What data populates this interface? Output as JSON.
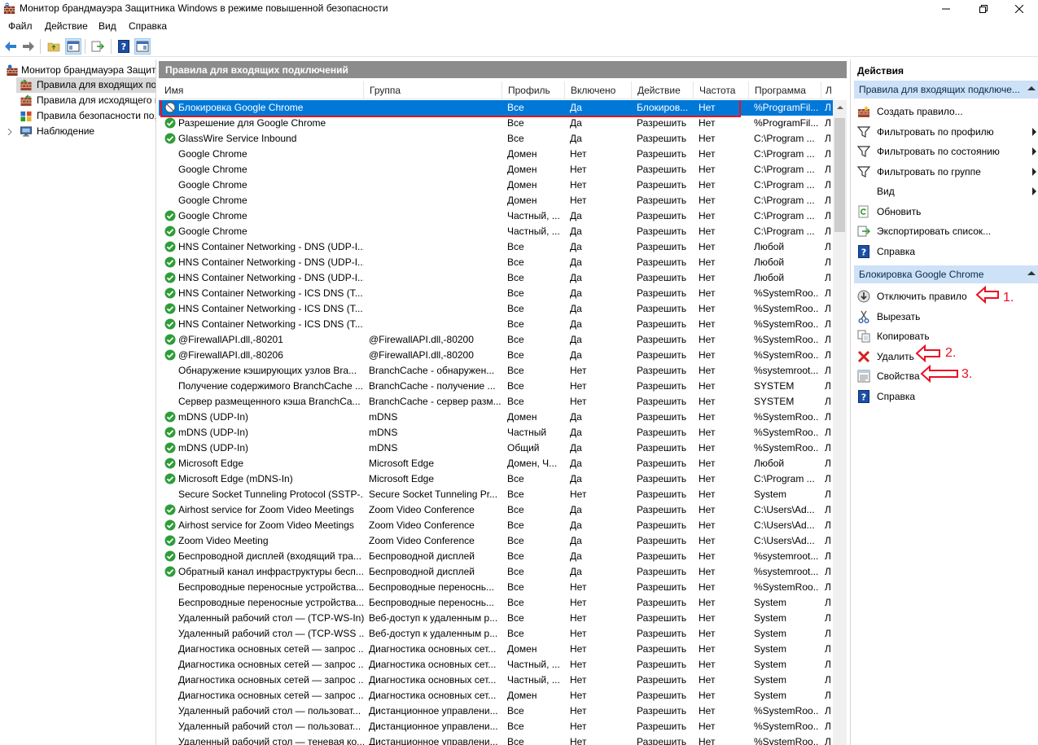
{
  "window": {
    "title": "Монитор брандмауэра Защитника Windows в режиме повышенной безопасности"
  },
  "menu": [
    "Файл",
    "Действие",
    "Вид",
    "Справка"
  ],
  "tree": [
    {
      "label": "Монитор брандмауэра Защит",
      "icon": "firewall-icon"
    },
    {
      "label": "Правила для входящих по",
      "icon": "inbound-rules-icon"
    },
    {
      "label": "Правила для исходящего п",
      "icon": "outbound-rules-icon"
    },
    {
      "label": "Правила безопасности по,",
      "icon": "security-rules-icon"
    },
    {
      "label": "Наблюдение",
      "icon": "monitoring-icon"
    }
  ],
  "middle": {
    "header": "Правила для входящих подключений",
    "columns": [
      "Имя",
      "Группа",
      "Профиль",
      "Включено",
      "Действие",
      "Частота",
      "Программа",
      "Л"
    ]
  },
  "rules": [
    {
      "icon": "block",
      "name": "Блокировка Google Chrome",
      "group": "",
      "profile": "Все",
      "enabled": "Да",
      "action": "Блокиров...",
      "freq": "Нет",
      "program": "%ProgramFil..."
    },
    {
      "icon": "allow",
      "name": "Разрешение для Google Chrome",
      "group": "",
      "profile": "Все",
      "enabled": "Да",
      "action": "Разрешить",
      "freq": "Нет",
      "program": "%ProgramFil..."
    },
    {
      "icon": "allow",
      "name": "GlassWire Service Inbound",
      "group": "",
      "profile": "Все",
      "enabled": "Да",
      "action": "Разрешить",
      "freq": "Нет",
      "program": "C:\\Program ..."
    },
    {
      "icon": "none",
      "name": "Google Chrome",
      "group": "",
      "profile": "Домен",
      "enabled": "Нет",
      "action": "Разрешить",
      "freq": "Нет",
      "program": "C:\\Program ..."
    },
    {
      "icon": "none",
      "name": "Google Chrome",
      "group": "",
      "profile": "Домен",
      "enabled": "Нет",
      "action": "Разрешить",
      "freq": "Нет",
      "program": "C:\\Program ..."
    },
    {
      "icon": "none",
      "name": "Google Chrome",
      "group": "",
      "profile": "Домен",
      "enabled": "Нет",
      "action": "Разрешить",
      "freq": "Нет",
      "program": "C:\\Program ..."
    },
    {
      "icon": "none",
      "name": "Google Chrome",
      "group": "",
      "profile": "Домен",
      "enabled": "Нет",
      "action": "Разрешить",
      "freq": "Нет",
      "program": "C:\\Program ..."
    },
    {
      "icon": "allow",
      "name": "Google Chrome",
      "group": "",
      "profile": "Частный, ...",
      "enabled": "Да",
      "action": "Разрешить",
      "freq": "Нет",
      "program": "C:\\Program ..."
    },
    {
      "icon": "allow",
      "name": "Google Chrome",
      "group": "",
      "profile": "Частный, ...",
      "enabled": "Да",
      "action": "Разрешить",
      "freq": "Нет",
      "program": "C:\\Program ..."
    },
    {
      "icon": "allow",
      "name": "HNS Container Networking - DNS (UDP-I...",
      "group": "",
      "profile": "Все",
      "enabled": "Да",
      "action": "Разрешить",
      "freq": "Нет",
      "program": "Любой"
    },
    {
      "icon": "allow",
      "name": "HNS Container Networking - DNS (UDP-I...",
      "group": "",
      "profile": "Все",
      "enabled": "Да",
      "action": "Разрешить",
      "freq": "Нет",
      "program": "Любой"
    },
    {
      "icon": "allow",
      "name": "HNS Container Networking - DNS (UDP-I...",
      "group": "",
      "profile": "Все",
      "enabled": "Да",
      "action": "Разрешить",
      "freq": "Нет",
      "program": "Любой"
    },
    {
      "icon": "allow",
      "name": "HNS Container Networking - ICS DNS (T...",
      "group": "",
      "profile": "Все",
      "enabled": "Да",
      "action": "Разрешить",
      "freq": "Нет",
      "program": "%SystemRoo..."
    },
    {
      "icon": "allow",
      "name": "HNS Container Networking - ICS DNS (T...",
      "group": "",
      "profile": "Все",
      "enabled": "Да",
      "action": "Разрешить",
      "freq": "Нет",
      "program": "%SystemRoo..."
    },
    {
      "icon": "allow",
      "name": "HNS Container Networking - ICS DNS (T...",
      "group": "",
      "profile": "Все",
      "enabled": "Да",
      "action": "Разрешить",
      "freq": "Нет",
      "program": "%SystemRoo..."
    },
    {
      "icon": "allow",
      "name": "@FirewallAPI.dll,-80201",
      "group": "@FirewallAPI.dll,-80200",
      "profile": "Все",
      "enabled": "Да",
      "action": "Разрешить",
      "freq": "Нет",
      "program": "%SystemRoo..."
    },
    {
      "icon": "allow",
      "name": "@FirewallAPI.dll,-80206",
      "group": "@FirewallAPI.dll,-80200",
      "profile": "Все",
      "enabled": "Да",
      "action": "Разрешить",
      "freq": "Нет",
      "program": "%SystemRoo..."
    },
    {
      "icon": "none",
      "name": "Обнаружение кэширующих узлов Bra...",
      "group": "BranchCache - обнаружен...",
      "profile": "Все",
      "enabled": "Нет",
      "action": "Разрешить",
      "freq": "Нет",
      "program": "%systemroot..."
    },
    {
      "icon": "none",
      "name": "Получение содержимого BranchCache ...",
      "group": "BranchCache - получение ...",
      "profile": "Все",
      "enabled": "Нет",
      "action": "Разрешить",
      "freq": "Нет",
      "program": "SYSTEM"
    },
    {
      "icon": "none",
      "name": "Сервер размещенного кэша BranchCa...",
      "group": "BranchCache - сервер разм...",
      "profile": "Все",
      "enabled": "Нет",
      "action": "Разрешить",
      "freq": "Нет",
      "program": "SYSTEM"
    },
    {
      "icon": "allow",
      "name": "mDNS (UDP-In)",
      "group": "mDNS",
      "profile": "Домен",
      "enabled": "Да",
      "action": "Разрешить",
      "freq": "Нет",
      "program": "%SystemRoo..."
    },
    {
      "icon": "allow",
      "name": "mDNS (UDP-In)",
      "group": "mDNS",
      "profile": "Частный",
      "enabled": "Да",
      "action": "Разрешить",
      "freq": "Нет",
      "program": "%SystemRoo..."
    },
    {
      "icon": "allow",
      "name": "mDNS (UDP-In)",
      "group": "mDNS",
      "profile": "Общий",
      "enabled": "Да",
      "action": "Разрешить",
      "freq": "Нет",
      "program": "%SystemRoo..."
    },
    {
      "icon": "allow",
      "name": "Microsoft Edge",
      "group": "Microsoft Edge",
      "profile": "Домен, Ч...",
      "enabled": "Да",
      "action": "Разрешить",
      "freq": "Нет",
      "program": "Любой"
    },
    {
      "icon": "allow",
      "name": "Microsoft Edge (mDNS-In)",
      "group": "Microsoft Edge",
      "profile": "Все",
      "enabled": "Да",
      "action": "Разрешить",
      "freq": "Нет",
      "program": "C:\\Program ..."
    },
    {
      "icon": "none",
      "name": "Secure Socket Tunneling Protocol (SSTP-...",
      "group": "Secure Socket Tunneling Pr...",
      "profile": "Все",
      "enabled": "Нет",
      "action": "Разрешить",
      "freq": "Нет",
      "program": "System"
    },
    {
      "icon": "allow",
      "name": "Airhost service for Zoom Video Meetings",
      "group": "Zoom Video Conference",
      "profile": "Все",
      "enabled": "Да",
      "action": "Разрешить",
      "freq": "Нет",
      "program": "C:\\Users\\Ad..."
    },
    {
      "icon": "allow",
      "name": "Airhost service for Zoom Video Meetings",
      "group": "Zoom Video Conference",
      "profile": "Все",
      "enabled": "Да",
      "action": "Разрешить",
      "freq": "Нет",
      "program": "C:\\Users\\Ad..."
    },
    {
      "icon": "allow",
      "name": "Zoom Video Meeting",
      "group": "Zoom Video Conference",
      "profile": "Все",
      "enabled": "Да",
      "action": "Разрешить",
      "freq": "Нет",
      "program": "C:\\Users\\Ad..."
    },
    {
      "icon": "allow",
      "name": "Беспроводной дисплей (входящий тра...",
      "group": "Беспроводной дисплей",
      "profile": "Все",
      "enabled": "Да",
      "action": "Разрешить",
      "freq": "Нет",
      "program": "%systemroot..."
    },
    {
      "icon": "allow",
      "name": "Обратный канал инфраструктуры бесп...",
      "group": "Беспроводной дисплей",
      "profile": "Все",
      "enabled": "Да",
      "action": "Разрешить",
      "freq": "Нет",
      "program": "%systemroot..."
    },
    {
      "icon": "none",
      "name": "Беспроводные переносные устройства...",
      "group": "Беспроводные переноснь...",
      "profile": "Все",
      "enabled": "Нет",
      "action": "Разрешить",
      "freq": "Нет",
      "program": "%SystemRoo..."
    },
    {
      "icon": "none",
      "name": "Беспроводные переносные устройства...",
      "group": "Беспроводные переноснь...",
      "profile": "Все",
      "enabled": "Нет",
      "action": "Разрешить",
      "freq": "Нет",
      "program": "System"
    },
    {
      "icon": "none",
      "name": "Удаленный рабочий стол — (TCP-WS-In)",
      "group": "Веб-доступ к удаленным р...",
      "profile": "Все",
      "enabled": "Нет",
      "action": "Разрешить",
      "freq": "Нет",
      "program": "System"
    },
    {
      "icon": "none",
      "name": "Удаленный рабочий стол — (TCP-WSS ...",
      "group": "Веб-доступ к удаленным р...",
      "profile": "Все",
      "enabled": "Нет",
      "action": "Разрешить",
      "freq": "Нет",
      "program": "System"
    },
    {
      "icon": "none",
      "name": "Диагностика основных сетей — запрос ...",
      "group": "Диагностика основных сет...",
      "profile": "Домен",
      "enabled": "Нет",
      "action": "Разрешить",
      "freq": "Нет",
      "program": "System"
    },
    {
      "icon": "none",
      "name": "Диагностика основных сетей — запрос ...",
      "group": "Диагностика основных сет...",
      "profile": "Частный, ...",
      "enabled": "Нет",
      "action": "Разрешить",
      "freq": "Нет",
      "program": "System"
    },
    {
      "icon": "none",
      "name": "Диагностика основных сетей — запрос ...",
      "group": "Диагностика основных сет...",
      "profile": "Частный, ...",
      "enabled": "Нет",
      "action": "Разрешить",
      "freq": "Нет",
      "program": "System"
    },
    {
      "icon": "none",
      "name": "Диагностика основных сетей — запрос ...",
      "group": "Диагностика основных сет...",
      "profile": "Домен",
      "enabled": "Нет",
      "action": "Разрешить",
      "freq": "Нет",
      "program": "System"
    },
    {
      "icon": "none",
      "name": "Удаленный рабочий стол — пользоват...",
      "group": "Дистанционное управлени...",
      "profile": "Все",
      "enabled": "Нет",
      "action": "Разрешить",
      "freq": "Нет",
      "program": "%SystemRoo..."
    },
    {
      "icon": "none",
      "name": "Удаленный рабочий стол — пользоват...",
      "group": "Дистанционное управлени...",
      "profile": "Все",
      "enabled": "Нет",
      "action": "Разрешить",
      "freq": "Нет",
      "program": "%SystemRoo..."
    },
    {
      "icon": "none",
      "name": "Удаленный рабочий стол — теневая ко...",
      "group": "Дистанционное управлени...",
      "profile": "Все",
      "enabled": "Нет",
      "action": "Разрешить",
      "freq": "Нет",
      "program": "%SystemRoo..."
    }
  ],
  "actions_panel": {
    "title": "Действия",
    "sections": [
      {
        "header": "Правила для входящих подключе...",
        "items": [
          {
            "label": "Создать правило...",
            "icon": "new-rule-icon",
            "submenu": false
          },
          {
            "label": "Фильтровать по профилю",
            "icon": "filter-icon",
            "submenu": true
          },
          {
            "label": "Фильтровать по состоянию",
            "icon": "filter-icon",
            "submenu": true
          },
          {
            "label": "Фильтровать по группе",
            "icon": "filter-icon",
            "submenu": true
          },
          {
            "label": "Вид",
            "icon": "none",
            "submenu": true
          },
          {
            "label": "Обновить",
            "icon": "refresh-icon",
            "submenu": false
          },
          {
            "label": "Экспортировать список...",
            "icon": "export-icon",
            "submenu": false
          },
          {
            "label": "Справка",
            "icon": "help-icon",
            "submenu": false
          }
        ]
      },
      {
        "header": "Блокировка Google Chrome",
        "items": [
          {
            "label": "Отключить правило",
            "icon": "disable-icon",
            "submenu": false
          },
          {
            "label": "Вырезать",
            "icon": "cut-icon",
            "submenu": false
          },
          {
            "label": "Копировать",
            "icon": "copy-icon",
            "submenu": false
          },
          {
            "label": "Удалить",
            "icon": "delete-icon",
            "submenu": false
          },
          {
            "label": "Свойства",
            "icon": "properties-icon",
            "submenu": false
          },
          {
            "label": "Справка",
            "icon": "help-icon",
            "submenu": false
          }
        ]
      }
    ]
  },
  "annotations": [
    "1.",
    "2.",
    "3."
  ],
  "colors": {
    "selection": "#0078d7",
    "header_gray": "#8c8c8c",
    "section_blue": "#cde1f7",
    "annotation_red": "#e81123",
    "allow_green": "#2e9d3a"
  }
}
